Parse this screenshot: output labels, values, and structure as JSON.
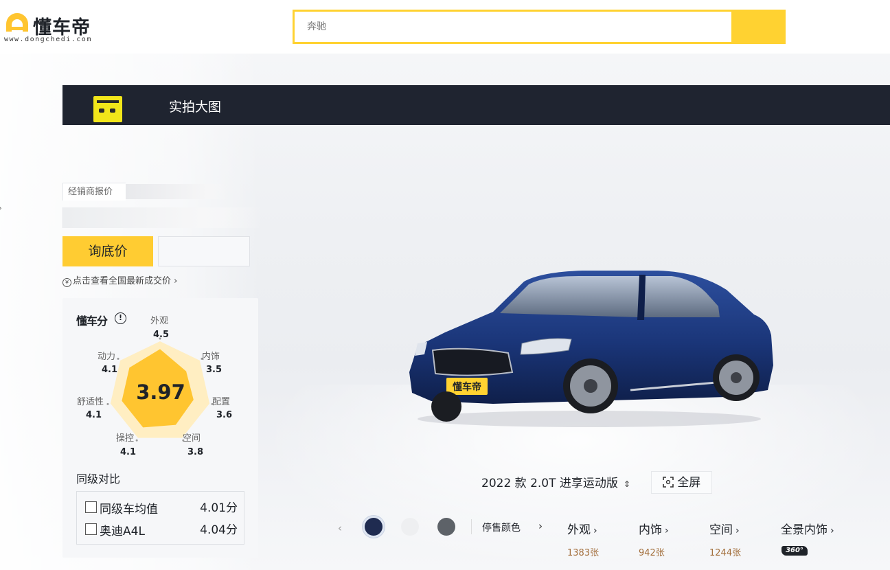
{
  "header": {
    "logo_text": "懂车帝",
    "logo_url": "www.dongchedi.com",
    "search_placeholder": "奔驰"
  },
  "gallery": {
    "nav_title": "实拍大图"
  },
  "pricing": {
    "dealer_label": "经销商报价",
    "ask_button": "询底价",
    "deal_link": "点击查看全国最新成交价 ›"
  },
  "score": {
    "brand": "懂车分",
    "info": "!",
    "total": "3.97",
    "total_value": 3.97,
    "max": 5,
    "dimensions": [
      {
        "label": "外观",
        "value": "4.5"
      },
      {
        "label": "内饰",
        "value": "3.5"
      },
      {
        "label": "配置",
        "value": "3.6"
      },
      {
        "label": "空间",
        "value": "3.8"
      },
      {
        "label": "操控",
        "value": "4.1"
      },
      {
        "label": "舒适性",
        "value": "4.1"
      },
      {
        "label": "动力",
        "value": "4.1"
      }
    ],
    "colors": {
      "fill": "#ffc530",
      "bg": "#ffeec2"
    }
  },
  "compare": {
    "title": "同级对比",
    "rows": [
      {
        "name": "同级车均值",
        "score": "4.01分"
      },
      {
        "name": "奥迪A4L",
        "score": "4.04分"
      }
    ]
  },
  "viewer": {
    "plate_text": "懂车帝",
    "version": "2022 款 2.0T 进享运动版",
    "version_icon": "⇕",
    "fullscreen": "全屏",
    "colors": [
      {
        "name": "swatch-blue",
        "hex": "#1f2b50",
        "selected": true
      },
      {
        "name": "swatch-white",
        "hex": "#eeeff1",
        "selected": false
      },
      {
        "name": "swatch-grey",
        "hex": "#5d6268",
        "selected": false
      }
    ],
    "discontinued_colors": "停售颜色",
    "categories": [
      {
        "label": "外观",
        "count": "1383张"
      },
      {
        "label": "内饰",
        "count": "942张"
      },
      {
        "label": "空间",
        "count": "1244张"
      },
      {
        "label": "全景内饰",
        "badge": "360°"
      }
    ]
  }
}
